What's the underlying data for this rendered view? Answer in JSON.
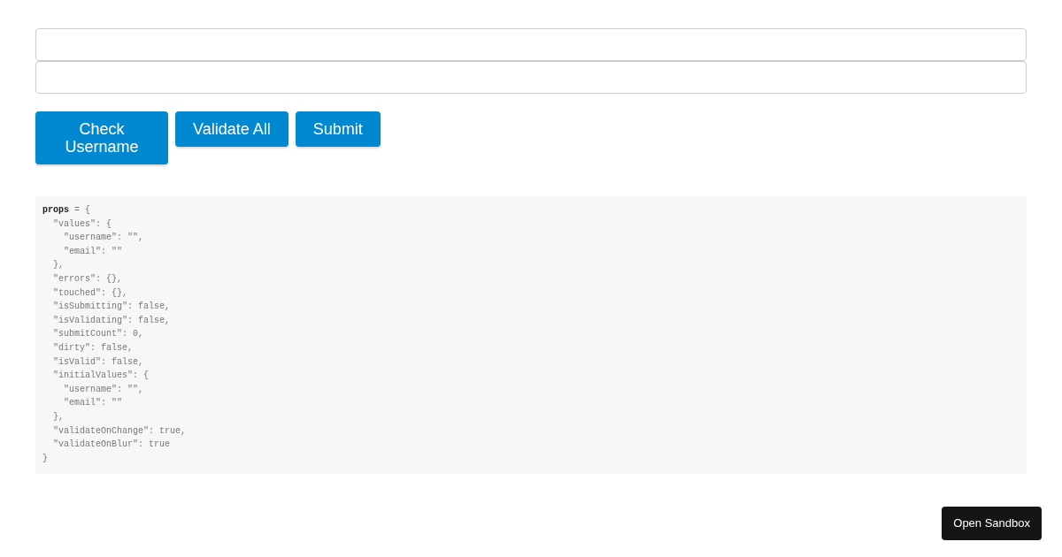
{
  "fields": [
    {
      "kind": "text"
    },
    {
      "kind": "text"
    }
  ],
  "buttons": [
    "Check Username",
    "Validate All",
    "Submit"
  ],
  "code": "**props** = {\n  \"values\": {\n    \"username\": \"\",\n    \"email\": \"\"\n  },\n  \"errors\": {},\n  \"touched\": {},\n  \"isSubmitting\": false,\n  \"isValidating\": false,\n  \"submitCount\": 0,\n  \"dirty\": false,\n  \"isValid\": false,\n  \"initialValues\": {\n    \"username\": \"\",\n    \"email\": \"\"\n  },\n  \"validateOnChange\": true,\n  \"validateOnBlur\": true\n}",
  "sandbox_button": "Open Sandbox"
}
